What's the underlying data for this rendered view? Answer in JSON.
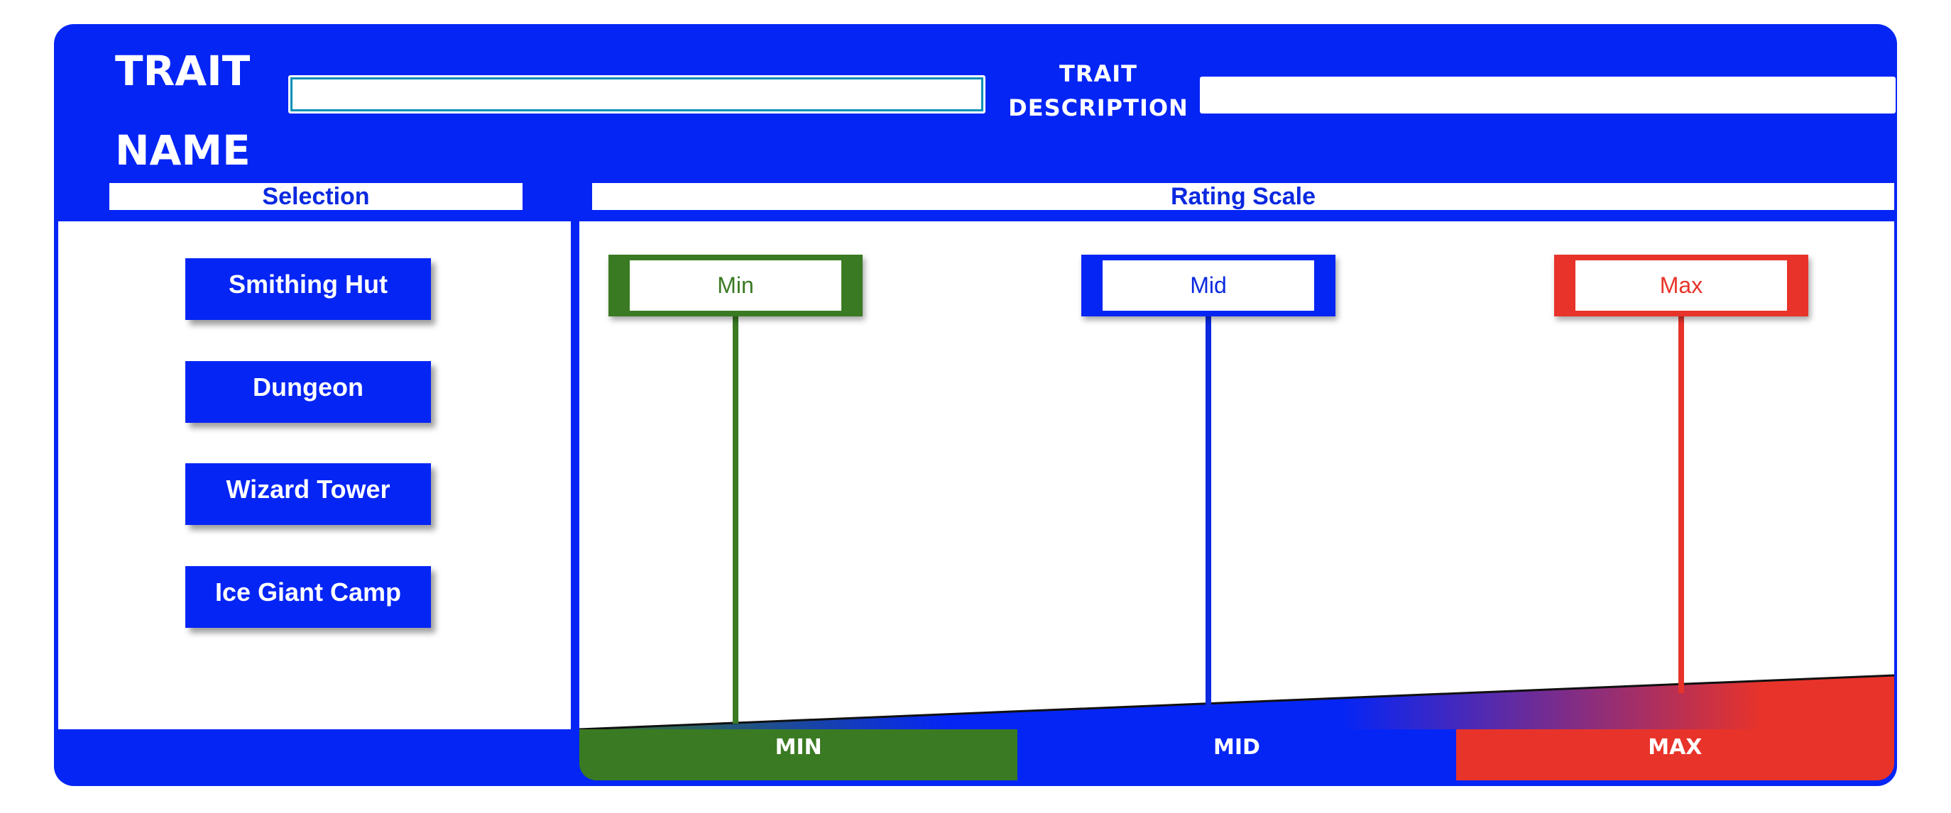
{
  "header": {
    "trait_name_label": "TRAIT NAME",
    "trait_name_value": "",
    "trait_description_label": "TRAIT DESCRIPTION",
    "trait_description_value": ""
  },
  "selection": {
    "header": "Selection",
    "items": [
      "Smithing Hut",
      "Dungeon",
      "Wizard Tower",
      "Ice Giant Camp"
    ]
  },
  "rating_scale": {
    "header": "Rating Scale",
    "markers": {
      "min": "Min",
      "mid": "Mid",
      "max": "Max"
    },
    "legend": {
      "min": "MIN",
      "mid": "MID",
      "max": "MAX"
    }
  },
  "colors": {
    "primary_blue": "#0525f5",
    "min_green": "#3a7a22",
    "mid_blue": "#0a29e0",
    "max_red": "#e8332a"
  }
}
